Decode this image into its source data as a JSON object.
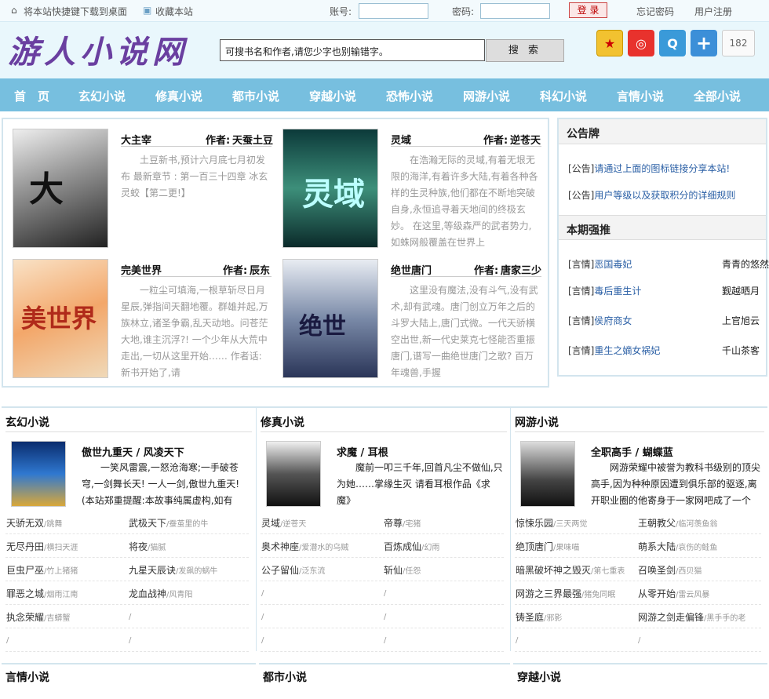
{
  "topbar": {
    "bookmark_desktop": "将本站快捷键下载到桌面",
    "add_favorite": "收藏本站",
    "account_label": "账号:",
    "password_label": "密码:",
    "login_button": "登 录",
    "forgot_password": "忘记密码",
    "register": "用户注册"
  },
  "header": {
    "logo_text": "游人小说网",
    "search_placeholder": "可搜书名和作者,请您少字也别输错字。",
    "search_button": "搜 索",
    "share_count": "182"
  },
  "nav": [
    "首　页",
    "玄幻小说",
    "修真小说",
    "都市小说",
    "穿越小说",
    "恐怖小说",
    "网游小说",
    "科幻小说",
    "言情小说",
    "全部小说"
  ],
  "featured": [
    {
      "title": "大主宰",
      "author_label": "作者:",
      "author": "天蚕土豆",
      "desc": "土豆新书,预计六月底七月初发布 最新章节 : 第一百三十四章 冰玄灵蛟【第二更!】"
    },
    {
      "title": "灵域",
      "author_label": "作者:",
      "author": "逆苍天",
      "desc": "在浩瀚无际的灵域,有着无垠无限的海洋,有着许多大陆,有着各种各样的生灵种族,他们都在不断地突破自身,永恒追寻着天地间的终极玄妙。 在这里,等级森严的武者势力,如蛛网般覆盖在世界上"
    },
    {
      "title": "完美世界",
      "author_label": "作者:",
      "author": "辰东",
      "desc": "一粒尘可填海,一根草斩尽日月星辰,弹指间天翻地覆。群雄并起,万族林立,诸圣争霸,乱天动地。问苍茫大地,谁主沉浮?! 一个少年从大荒中走出,一切从这里开始…… 作者话:新书开始了,请"
    },
    {
      "title": "绝世唐门",
      "author_label": "作者:",
      "author": "唐家三少",
      "desc": "这里没有魔法,没有斗气,没有武术,却有武魂。唐门创立万年之后的斗罗大陆上,唐门式微。一代天骄横空出世,新一代史莱克七怪能否重振唐门,谱写一曲绝世唐门之歌? 百万年魂兽,手握"
    }
  ],
  "notice": {
    "title": "公告牌",
    "items": [
      {
        "tag": "[公告]",
        "text": "请通过上面的图标链接分享本站!"
      },
      {
        "tag": "[公告]",
        "text": "用户等级以及获取积分的详细规则"
      }
    ]
  },
  "recommend": {
    "title": "本期强推",
    "items": [
      {
        "tag": "[言情]",
        "title": "恶国毒妃",
        "author": "青青的悠然"
      },
      {
        "tag": "[言情]",
        "title": "毒后重生计",
        "author": "觐越晒月"
      },
      {
        "tag": "[言情]",
        "title": "侯府商女",
        "author": "上官旭云"
      },
      {
        "tag": "[言情]",
        "title": "重生之嫡女祸妃",
        "author": "千山茶客"
      }
    ]
  },
  "categories": [
    {
      "name": "玄幻小说",
      "top_title": "傲世九重天 / 风凌天下",
      "top_desc": "一笑风雷震,一怒沧海寒;一手破苍穹,一剑舞长天! 一人一剑,傲世九重天! (本站郑重提醒:本故事纯属虚构,如有",
      "rows": [
        [
          {
            "n": "天骄无双",
            "a": "/跳舞"
          },
          {
            "n": "武极天下",
            "a": "/蚕茧里的牛"
          }
        ],
        [
          {
            "n": "无尽丹田",
            "a": "/横扫天涯"
          },
          {
            "n": "将夜",
            "a": "/猫腻"
          }
        ],
        [
          {
            "n": "巨虫尸巫",
            "a": "/竹上猪猪"
          },
          {
            "n": "九星天辰诀",
            "a": "/发飙的蜗牛"
          }
        ],
        [
          {
            "n": "罪恶之城",
            "a": "/烟雨江南"
          },
          {
            "n": "龙血战神",
            "a": "/风青阳"
          }
        ],
        [
          {
            "n": "执念荣耀",
            "a": "/吉蟒蟹"
          },
          {
            "n": "",
            "a": "/"
          }
        ],
        [
          {
            "n": "",
            "a": "/"
          },
          {
            "n": "",
            "a": "/"
          }
        ]
      ]
    },
    {
      "name": "修真小说",
      "top_title": "求魔 / 耳根",
      "top_desc": "魔前一叩三千年,回首凡尘不做仙,只为她……掌缘生灭 请看耳根作品《求魔》",
      "rows": [
        [
          {
            "n": "灵域",
            "a": "/逆苍天"
          },
          {
            "n": "帝尊",
            "a": "/宅猪"
          }
        ],
        [
          {
            "n": "奥术神座",
            "a": "/爱潜水的乌贼"
          },
          {
            "n": "百炼成仙",
            "a": "/幻雨"
          }
        ],
        [
          {
            "n": "公子留仙",
            "a": "/泛东流"
          },
          {
            "n": "斩仙",
            "a": "/任怨"
          }
        ],
        [
          {
            "n": "",
            "a": "/"
          },
          {
            "n": "",
            "a": "/"
          }
        ],
        [
          {
            "n": "",
            "a": "/"
          },
          {
            "n": "",
            "a": "/"
          }
        ],
        [
          {
            "n": "",
            "a": "/"
          },
          {
            "n": "",
            "a": "/"
          }
        ]
      ]
    },
    {
      "name": "网游小说",
      "top_title": "全职高手 / 蝴蝶蓝",
      "top_desc": "网游荣耀中被誉为教科书级别的顶尖高手,因为种种原因遭到俱乐部的驱逐,离开职业圈的他寄身于一家网吧成了一个",
      "rows": [
        [
          {
            "n": "惊悚乐园",
            "a": "/三天两觉"
          },
          {
            "n": "王朝教父",
            "a": "/临河羡鱼翁"
          }
        ],
        [
          {
            "n": "绝顶唐门",
            "a": "/果味喵"
          },
          {
            "n": "萌系大陆",
            "a": "/哀伤的鲑鱼"
          }
        ],
        [
          {
            "n": "暗黑破坏神之毁灭",
            "a": "/第七重表"
          },
          {
            "n": "召唤圣剑",
            "a": "/西贝猫"
          }
        ],
        [
          {
            "n": "网游之三界最强",
            "a": "/猪兔同眠"
          },
          {
            "n": "从零开始",
            "a": "/雷云风暴"
          }
        ],
        [
          {
            "n": "铸圣庭",
            "a": "/邪影"
          },
          {
            "n": "网游之剑走偏锋",
            "a": "/黑手手的老"
          }
        ],
        [
          {
            "n": "",
            "a": "/"
          },
          {
            "n": "",
            "a": "/"
          }
        ]
      ]
    }
  ],
  "bottom_categories": [
    "言情小说",
    "都市小说",
    "穿越小说"
  ]
}
